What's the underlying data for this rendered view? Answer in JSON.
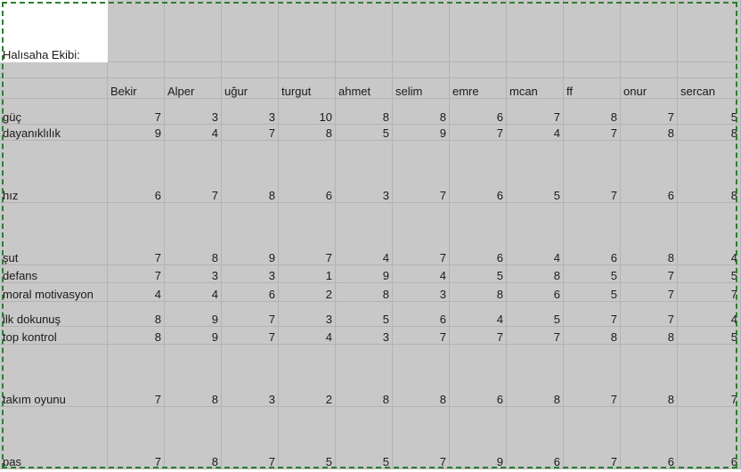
{
  "title": "Halısaha Ekibi:",
  "players": [
    "Bekir",
    "Alper",
    "uğur",
    "turgut",
    "ahmet",
    "selim",
    "emre",
    "mcan",
    "ff",
    "onur",
    "sercan"
  ],
  "rows": [
    {
      "label": "güç",
      "values": [
        7,
        3,
        3,
        10,
        8,
        8,
        6,
        7,
        8,
        7,
        5
      ]
    },
    {
      "label": "dayanıklılık",
      "values": [
        9,
        4,
        7,
        8,
        5,
        9,
        7,
        4,
        7,
        8,
        8
      ]
    },
    {
      "label": "hız",
      "values": [
        6,
        7,
        8,
        6,
        3,
        7,
        6,
        5,
        7,
        6,
        8
      ]
    },
    {
      "label": "şut",
      "values": [
        7,
        8,
        9,
        7,
        4,
        7,
        6,
        4,
        6,
        8,
        4
      ]
    },
    {
      "label": "defans",
      "values": [
        7,
        3,
        3,
        1,
        9,
        4,
        5,
        8,
        5,
        7,
        5
      ]
    },
    {
      "label": "moral motivasyon",
      "values": [
        4,
        4,
        6,
        2,
        8,
        3,
        8,
        6,
        5,
        7,
        7
      ]
    },
    {
      "label": "ilk dokunuş",
      "values": [
        8,
        9,
        7,
        3,
        5,
        6,
        4,
        5,
        7,
        7,
        4
      ]
    },
    {
      "label": "top kontrol",
      "values": [
        8,
        9,
        7,
        4,
        3,
        7,
        7,
        7,
        8,
        8,
        5
      ]
    },
    {
      "label": "takım oyunu",
      "values": [
        7,
        8,
        3,
        2,
        8,
        8,
        6,
        8,
        7,
        8,
        7
      ]
    },
    {
      "label": "pas",
      "values": [
        7,
        8,
        7,
        5,
        5,
        7,
        9,
        6,
        7,
        6,
        6
      ]
    }
  ]
}
